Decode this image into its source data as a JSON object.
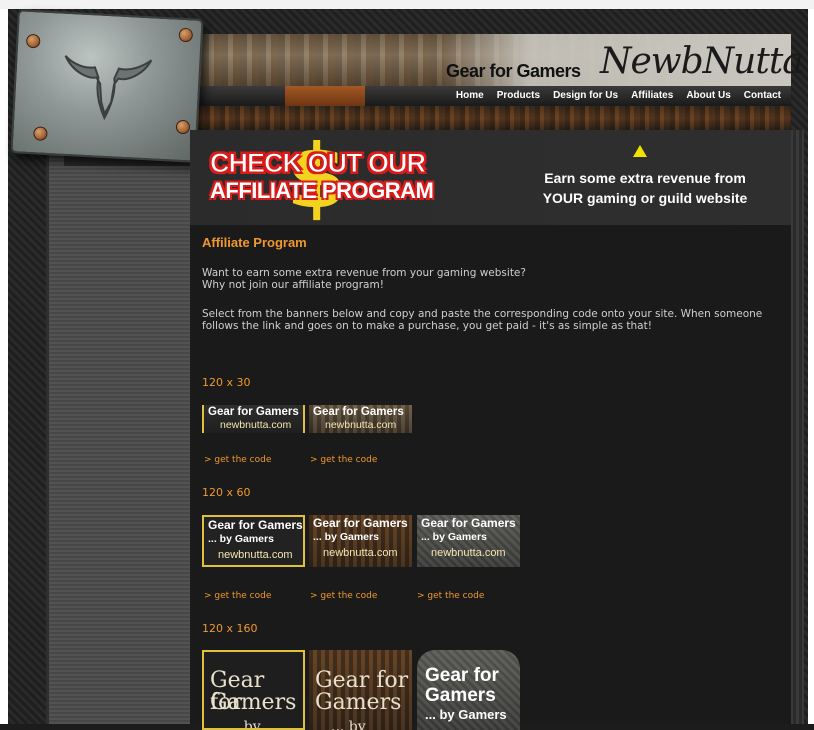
{
  "header": {
    "brand_tagline": "Gear for Gamers",
    "brand_name": "NewbNutta"
  },
  "nav": {
    "items": [
      "Home",
      "Products",
      "Design for Us",
      "Affiliates",
      "About Us",
      "Contact"
    ]
  },
  "banner": {
    "headline_line1": "CHECK OUT OUR",
    "headline_line2": "AFFILIATE PROGRAM",
    "dollar_glyph": "$",
    "pitch_line1": "Earn some extra revenue from",
    "pitch_line2": "YOUR gaming or guild website"
  },
  "main": {
    "title": "Affiliate Program",
    "intro_line1": "Want to earn some extra revenue from your gaming website?",
    "intro_line2": "Why not join our affiliate program!",
    "instructions": "Select from the banners below and copy and paste the corresponding code onto your site. When someone follows the link and goes on to make a purchase, you get paid - it's as simple as that!",
    "get_code_label": "> get the code",
    "sections": [
      {
        "size_label": "120 x 30",
        "banners": [
          {
            "line1": "Gear for Gamers",
            "line2": "newbnutta.com"
          },
          {
            "line1": "Gear for Gamers",
            "line2": "newbnutta.com"
          }
        ]
      },
      {
        "size_label": "120 x 60",
        "banners": [
          {
            "line1": "Gear for Gamers",
            "line2": "... by Gamers",
            "line3": "newbnutta.com"
          },
          {
            "line1": "Gear for Gamers",
            "line2": "... by Gamers",
            "line3": "newbnutta.com"
          },
          {
            "line1": "Gear for Gamers",
            "line2": "... by Gamers",
            "line3": "newbnutta.com"
          }
        ]
      },
      {
        "size_label": "120 x 160",
        "banners": [
          {
            "line1": "Gear for",
            "line2": "Gamers",
            "line3": "... by Gamers"
          },
          {
            "line1": "Gear for",
            "line2": "Gamers",
            "line3": "... by Gamers"
          },
          {
            "line1": "Gear for",
            "line2": "Gamers",
            "line3": "... by Gamers"
          }
        ]
      }
    ]
  }
}
